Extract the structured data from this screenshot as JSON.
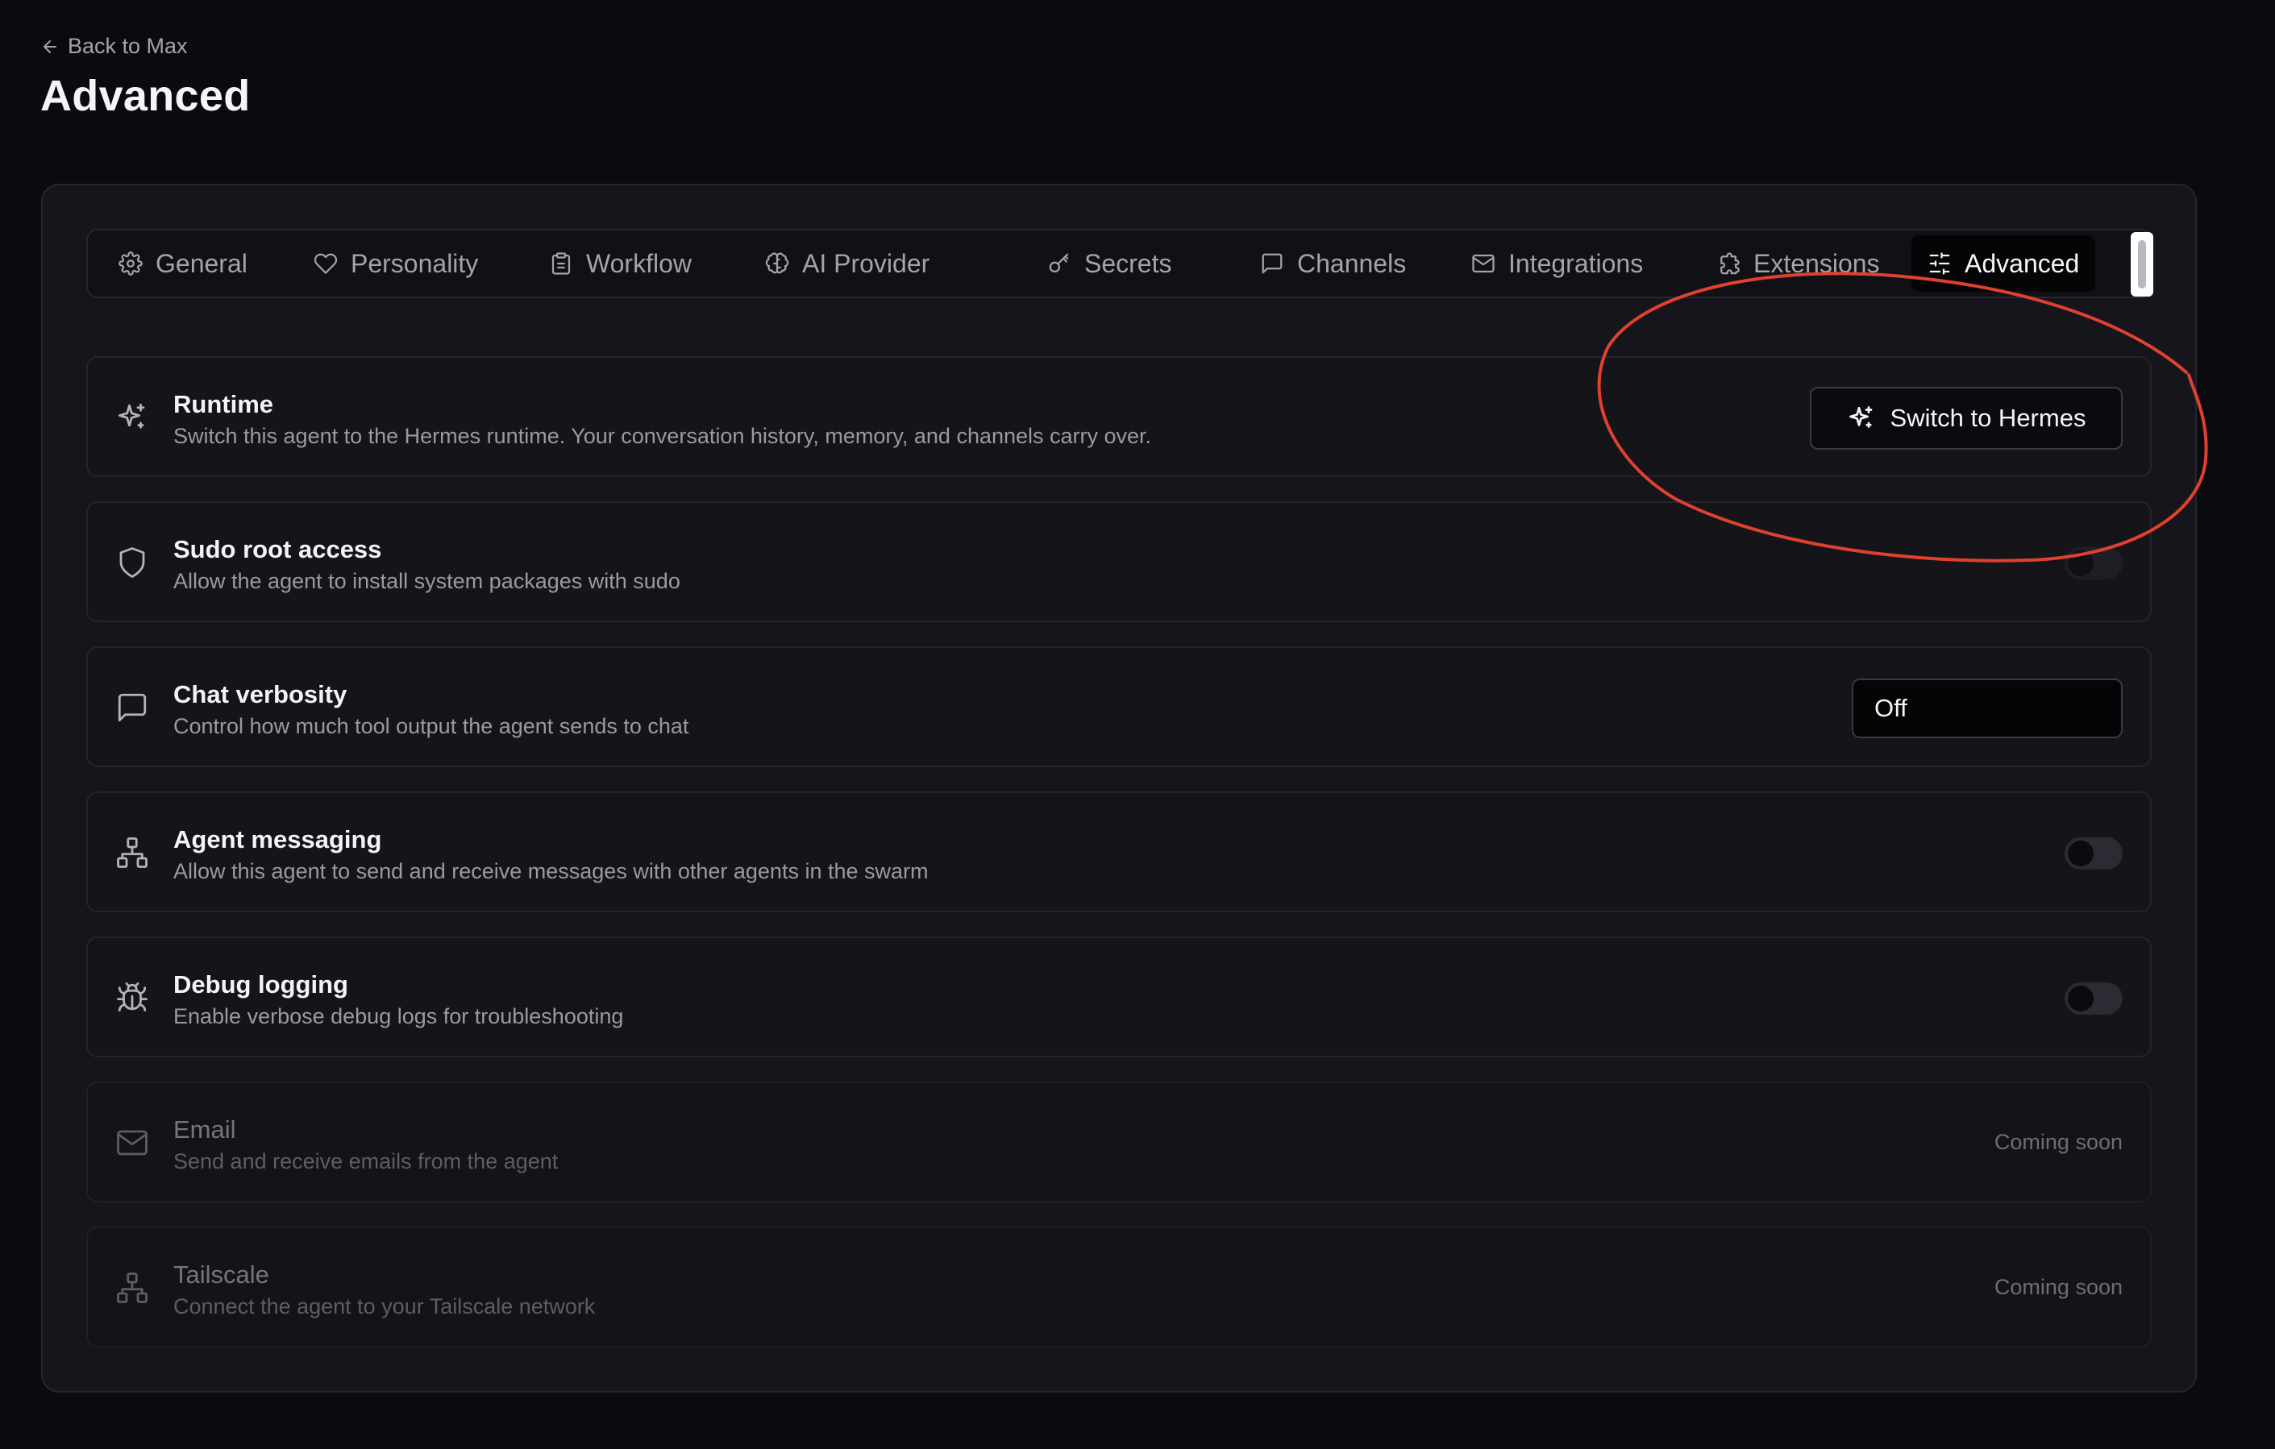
{
  "header": {
    "back_label": "Back to Max",
    "title": "Advanced"
  },
  "tabs": [
    {
      "label": "General",
      "icon": "gear-icon"
    },
    {
      "label": "Personality",
      "icon": "heart-icon"
    },
    {
      "label": "Workflow",
      "icon": "clipboard-icon"
    },
    {
      "label": "AI Provider",
      "icon": "brain-icon"
    },
    {
      "label": "Secrets",
      "icon": "key-icon"
    },
    {
      "label": "Channels",
      "icon": "message-square-icon"
    },
    {
      "label": "Integrations",
      "icon": "mail-icon"
    },
    {
      "label": "Extensions",
      "icon": "puzzle-icon"
    },
    {
      "label": "Advanced",
      "icon": "sliders-icon",
      "active": true
    }
  ],
  "settings": {
    "runtime": {
      "title": "Runtime",
      "description": "Switch this agent to the Hermes runtime. Your conversation history, memory, and channels carry over.",
      "button_label": "Switch to Hermes",
      "icon": "sparkles-icon"
    },
    "sudo": {
      "title": "Sudo root access",
      "description": "Allow the agent to install system packages with sudo",
      "enabled": false,
      "icon": "shield-icon"
    },
    "verbosity": {
      "title": "Chat verbosity",
      "description": "Control how much tool output the agent sends to chat",
      "selected": "Off",
      "icon": "message-square-icon"
    },
    "agent_messaging": {
      "title": "Agent messaging",
      "description": "Allow this agent to send and receive messages with other agents in the swarm",
      "enabled": false,
      "icon": "network-icon"
    },
    "debug": {
      "title": "Debug logging",
      "description": "Enable verbose debug logs for troubleshooting",
      "enabled": false,
      "icon": "bug-icon"
    },
    "email": {
      "title": "Email",
      "description": "Send and receive emails from the agent",
      "status": "Coming soon",
      "icon": "mail-icon"
    },
    "tailscale": {
      "title": "Tailscale",
      "description": "Connect the agent to your Tailscale network",
      "status": "Coming soon",
      "icon": "network-icon"
    }
  },
  "colors": {
    "background": "#0b0b0f",
    "card": "#15151b",
    "annotation": "#e0412f"
  }
}
